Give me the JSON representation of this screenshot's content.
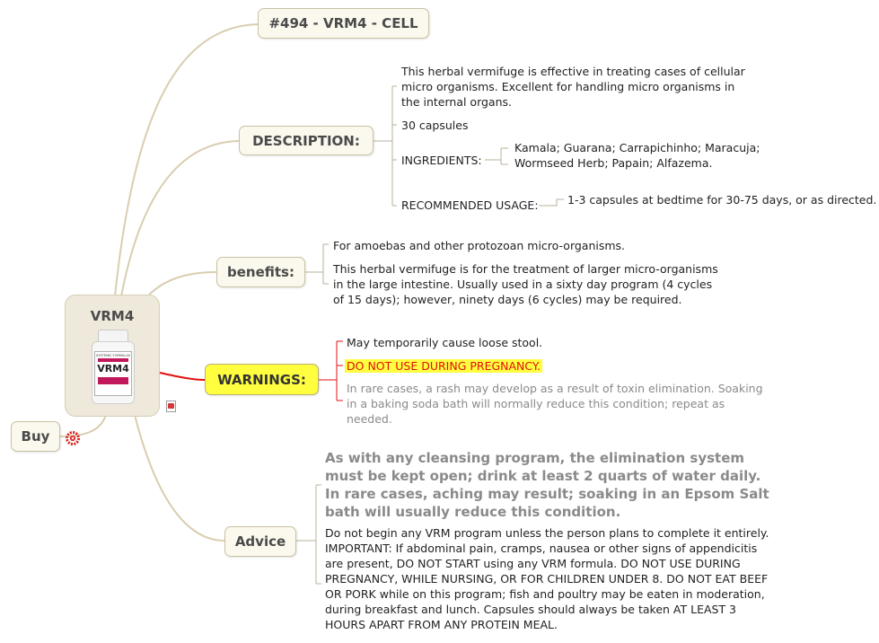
{
  "central": {
    "title": "VRM4",
    "bottle_label": "VRM4",
    "bottle_brand": "SYSTEMIC FORMULAS"
  },
  "buy": {
    "label": "Buy"
  },
  "branches": {
    "title": "#494 - VRM4 - CELL",
    "description": {
      "label": "DESCRIPTION:",
      "text": "This herbal vermifuge is effective in treating cases of cellular micro organisms. Excellent for handling micro organisms in the internal organs.",
      "capsules": "30 capsules",
      "ingredients_label": "INGREDIENTS:",
      "ingredients": "Kamala; Guarana; Carrapichinho; Maracuja; Wormseed Herb; Papain; Alfazema.",
      "usage_label": "RECOMMENDED USAGE:",
      "usage": "1-3 capsules at bedtime for 30-75 days, or as directed."
    },
    "benefits": {
      "label": "benefits:",
      "item1": "For amoebas and other protozoan micro-organisms.",
      "item2": "This herbal vermifuge is for the treatment of larger micro-organisms in the large intestine. Usually used in a sixty day program (4 cycles of 15 days); however, ninety days (6 cycles) may be required."
    },
    "warnings": {
      "label": "WARNINGS:",
      "item1": "May temporarily cause loose stool.",
      "item2": "DO NOT USE DURING PREGNANCY.",
      "item3": "In rare cases, a rash may develop as a result of toxin elimination. Soaking in a baking soda bath will normally reduce this condition; repeat as needed."
    },
    "advice": {
      "label": "Advice",
      "item1": "As with any cleansing program, the elimination system must be kept open; drink at least 2 quarts of water daily. In rare cases, aching may result; soaking in an Epsom Salt bath will usually reduce this condition.",
      "item2": "Do not begin any VRM program unless the person plans to complete it entirely. IMPORTANT: If abdominal pain, cramps, nausea or other signs of appendicitis are present, DO NOT START using any VRM formula. DO NOT USE DURING PREGNANCY, WHILE NURSING, OR FOR CHILDREN UNDER 8. DO NOT EAT BEEF OR PORK while on this program; fish and poultry may be eaten in moderation, during breakfast and lunch. Capsules should always be taken AT LEAST 3 HOURS APART FROM ANY PROTEIN MEAL."
    }
  },
  "colors": {
    "connector": "#d8ceb0",
    "warning_connector": "#e01010",
    "highlight": "#ffff40",
    "warning_text": "#e01010"
  }
}
